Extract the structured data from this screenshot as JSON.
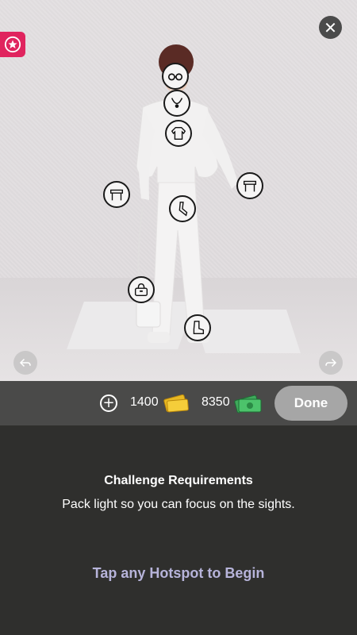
{
  "stage": {
    "hotspots": [
      {
        "name": "glasses"
      },
      {
        "name": "necklace"
      },
      {
        "name": "top"
      },
      {
        "name": "left-bracelet"
      },
      {
        "name": "right-bracelet"
      },
      {
        "name": "pants"
      },
      {
        "name": "handbag"
      },
      {
        "name": "boots"
      }
    ]
  },
  "currency": {
    "tickets": "1400",
    "cash": "8350",
    "done_label": "Done"
  },
  "challenge": {
    "title": "Challenge Requirements",
    "description": "Pack light so you can focus on the sights.",
    "hint": "Tap any Hotspot to Begin"
  },
  "colors": {
    "accent_pink": "#e0245e",
    "hint_lavender": "#b7b4da",
    "panel_dark": "#2f2f2d"
  }
}
